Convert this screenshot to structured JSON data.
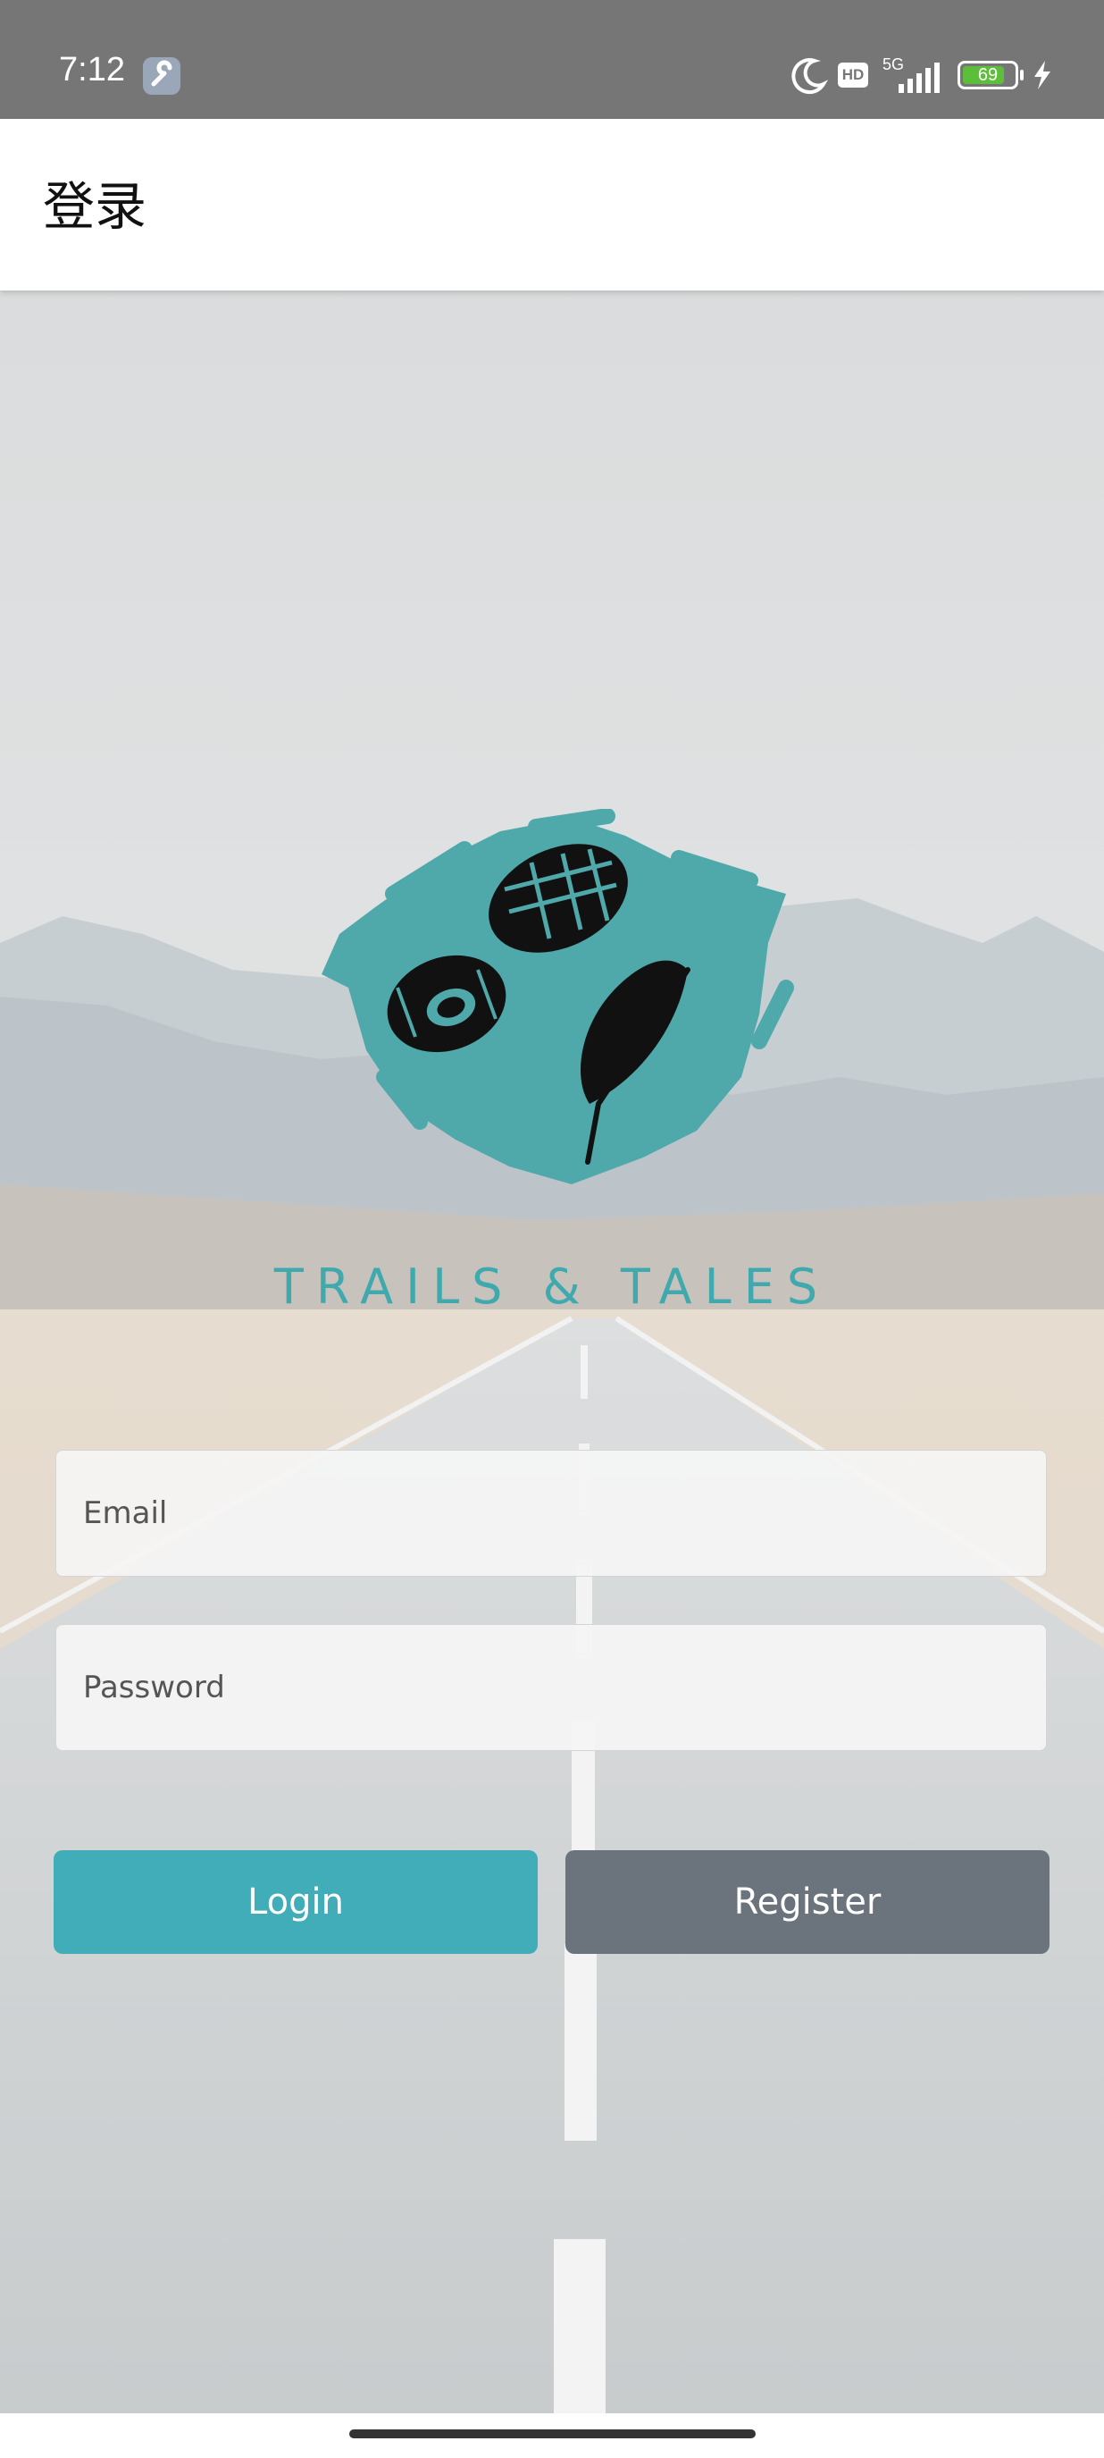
{
  "status_bar": {
    "time": "7:12",
    "network": "5G",
    "hd_badge": "HD",
    "battery_level": "69",
    "icons": [
      "wrench-icon",
      "moon-icon",
      "hd-icon",
      "signal-icon",
      "battery-icon",
      "charging-icon"
    ]
  },
  "app_bar": {
    "title": "登录"
  },
  "brand": {
    "name": "TRAILS & TALES",
    "accent_color": "#3fa9ad"
  },
  "form": {
    "email_placeholder": "Email",
    "password_placeholder": "Password",
    "login_label": "Login",
    "register_label": "Register",
    "login_color": "#41adb9",
    "register_color": "#6b737c"
  }
}
